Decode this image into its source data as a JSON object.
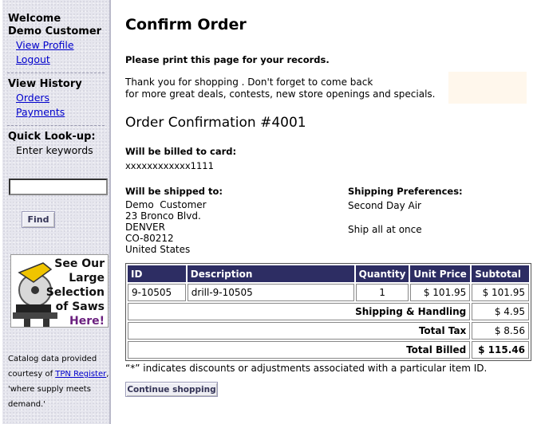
{
  "sidebar": {
    "welcome": "Welcome",
    "user_name": "Demo Customer",
    "view_profile": "View Profile",
    "logout": "Logout",
    "history_heading": "View History",
    "orders": "Orders",
    "payments": "Payments",
    "lookup_heading": "Quick Look-up:",
    "lookup_hint": "Enter keywords",
    "search_value": "",
    "find_button": "Find",
    "ad": {
      "line1": "See Our",
      "line2": "Large",
      "line3": "Selection",
      "line4": "of Saws",
      "line5": "Here!"
    },
    "credit": {
      "prefix": "Catalog data provided courtesy of ",
      "link": "TPN Register",
      "suffix": ", 'where supply meets demand.'"
    }
  },
  "main": {
    "title": "Confirm Order",
    "print_note": "Please print this page for your records.",
    "thanks_line1": "Thank you for shopping . Don't forget to come back",
    "thanks_line2": "for more great deals, contests, new store openings and specials.",
    "confirmation": "Order Confirmation #4001",
    "billed_label": "Will be billed to card:",
    "card_number": "xxxxxxxxxxxx1111",
    "shipped_label": "Will be shipped to:",
    "address": {
      "name": "Demo  Customer",
      "street": "23 Bronco Blvd.",
      "city": "DENVER",
      "state_zip": "CO-80212",
      "country": "United States"
    },
    "pref_label": "Shipping Preferences:",
    "ship_method": "Second Day Air",
    "ship_mode": "Ship all at once",
    "table": {
      "headers": {
        "id": "ID",
        "description": "Description",
        "quantity": "Quantity",
        "unit_price": "Unit Price",
        "subtotal": "Subtotal"
      },
      "rows": [
        {
          "id": "9-10505",
          "description": "drill-9-10505",
          "quantity": "1",
          "unit_price": "$ 101.95",
          "subtotal": "$ 101.95"
        }
      ],
      "shipping_label": "Shipping & Handling",
      "shipping_value": "$ 4.95",
      "tax_label": "Total Tax",
      "tax_value": "$ 8.56",
      "total_label": "Total Billed",
      "total_value": "$ 115.46"
    },
    "footnote": "“*” indicates discounts or adjustments associated with a particular item ID.",
    "continue_button": "Continue shopping"
  },
  "colors": {
    "table_header_bg": "#2d2d63",
    "link": "#0000cc",
    "sidebar_bg": "#e6e6ee"
  }
}
